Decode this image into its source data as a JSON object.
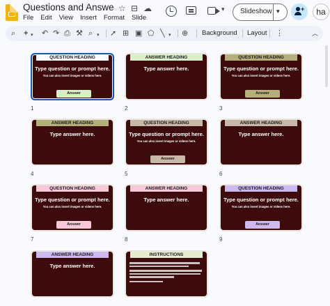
{
  "app": {
    "doc_title": "Questions and Answers T...",
    "menus": [
      "File",
      "Edit",
      "View",
      "Insert",
      "Format",
      "Slide"
    ],
    "slideshow_label": "Slideshow",
    "avatar_text": "ha"
  },
  "toolbar": {
    "background_label": "Background",
    "layout_label": "Layout",
    "zoom_icon_text": "⌕"
  },
  "slides": [
    {
      "num": "1",
      "heading": "QUESTION HEADING",
      "main": "Type question or prompt here.",
      "sub": "You can also insert images or videos here.",
      "button": "Answer",
      "head_color": "#ffffff",
      "btn_color": "#d8f0c8",
      "selected": true
    },
    {
      "num": "2",
      "heading": "ANSWER HEADING",
      "main": "Type answer here.",
      "head_color": "#d8f0c8"
    },
    {
      "num": "3",
      "heading": "QUESTION HEADING",
      "main": "Type question or prompt here.",
      "sub": "You can also insert images or videos here.",
      "button": "Answer",
      "head_color": "#b5b07a",
      "btn_color": "#b5b07a"
    },
    {
      "num": "4",
      "heading": "ANSWER HEADING",
      "main": "Type answer here.",
      "head_color": "#b5b07a"
    },
    {
      "num": "5",
      "heading": "QUESTION HEADING",
      "main": "Type question or prompt here.",
      "sub": "You can also insert images or videos here.",
      "button": "Answer",
      "head_color": "#c8b8a8",
      "btn_color": "#c8b8a8"
    },
    {
      "num": "6",
      "heading": "ANSWER HEADING",
      "main": "Type answer here.",
      "head_color": "#c8b8a8"
    },
    {
      "num": "7",
      "heading": "QUESTION HEADING",
      "main": "Type question or prompt here.",
      "sub": "You can also insert images or videos here.",
      "button": "Answer",
      "head_color": "#f6c8d8",
      "btn_color": "#f6c8d8"
    },
    {
      "num": "8",
      "heading": "ANSWER HEADING",
      "main": "Type answer here.",
      "head_color": "#f6c8d8"
    },
    {
      "num": "9",
      "heading": "QUESTION HEADING",
      "main": "Type question or prompt here.",
      "sub": "You can also insert images or videos here.",
      "button": "Answer",
      "head_color": "#cdb8f0",
      "btn_color": "#cdb8f0"
    },
    {
      "num": "",
      "heading": "ANSWER HEADING",
      "main": "Type answer here.",
      "head_color": "#cdb8f0"
    },
    {
      "num": "",
      "heading": "INSTRUCTIONS",
      "head_color": "#e6ecd0"
    }
  ],
  "colors": {
    "slide_bg": "#3d0b0b",
    "selected_border": "#0b57d0",
    "share_bg": "#c2e7ff"
  }
}
